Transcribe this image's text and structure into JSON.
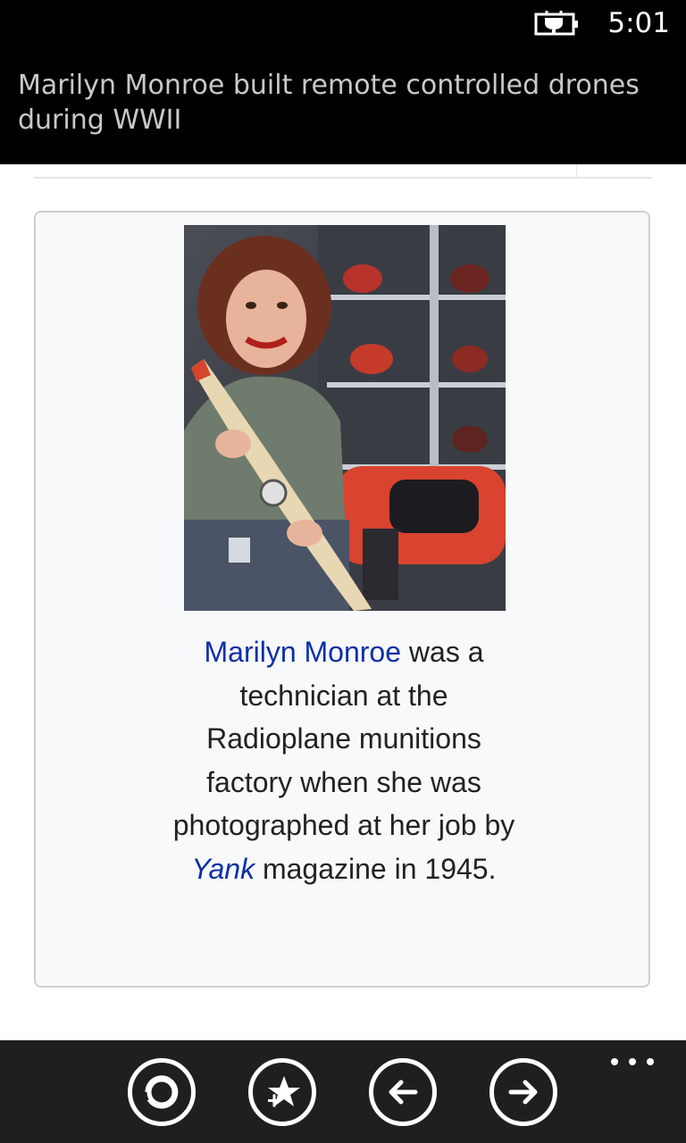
{
  "status": {
    "time": "5:01",
    "battery_icon": "battery-charging-icon"
  },
  "header": {
    "title": "Marilyn Monroe built remote controlled drones during WWII"
  },
  "article": {
    "photo_alt": "Marilyn Monroe holding an aircraft propeller",
    "caption": {
      "link_name": "Marilyn Monroe",
      "text_1": " was a technician at the Radioplane munitions factory when she was photographed at her job by ",
      "link_magazine": "Yank",
      "text_2": " magazine in 1945."
    }
  },
  "appbar": {
    "buttons": [
      {
        "icon": "refresh-icon"
      },
      {
        "icon": "add-favorite-icon"
      },
      {
        "icon": "back-arrow-icon"
      },
      {
        "icon": "forward-arrow-icon"
      }
    ],
    "more_icon": "ellipsis-icon"
  },
  "colors": {
    "link": "#0b2fa6",
    "header_bg": "#000000",
    "appbar_bg": "#1f1f1f",
    "title_text": "#c9c9c9"
  }
}
